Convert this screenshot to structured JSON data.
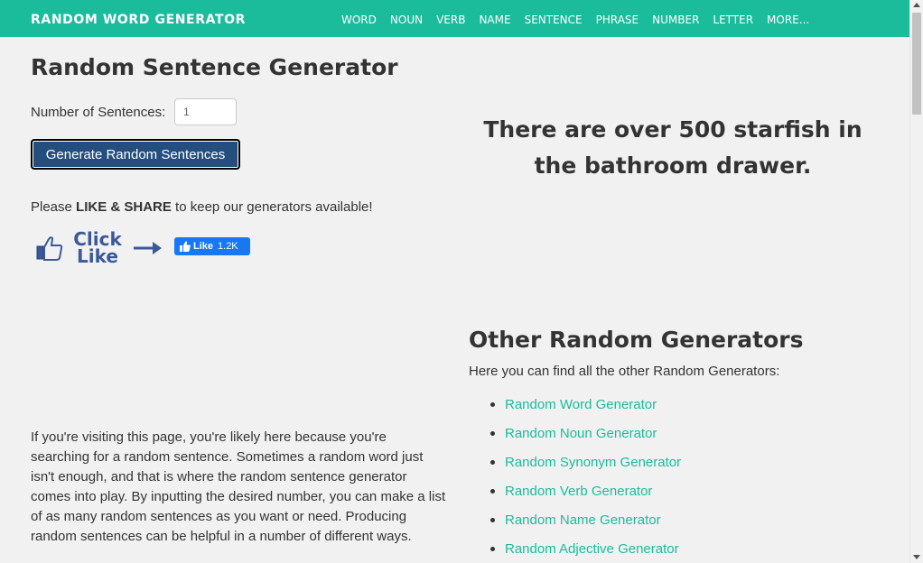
{
  "brand": "RANDOM WORD GENERATOR",
  "nav": [
    "WORD",
    "NOUN",
    "VERB",
    "NAME",
    "SENTENCE",
    "PHRASE",
    "NUMBER",
    "LETTER",
    "MORE..."
  ],
  "page_title": "Random Sentence Generator",
  "form": {
    "count_label": "Number of Sentences:",
    "count_value": "1",
    "button": "Generate Random Sentences"
  },
  "share": {
    "prefix": "Please ",
    "bold": "LIKE & SHARE",
    "suffix": " to keep our generators available!"
  },
  "click_like": {
    "line1": "Click",
    "line2": "Like"
  },
  "fb_like": {
    "label": "Like",
    "count": "1.2K"
  },
  "generated_sentence": "There are over 500 starfish in the bathroom drawer.",
  "description": "If you're visiting this page, you're likely here because you're searching for a random sentence. Sometimes a random word just isn't enough, and that is where the random sentence generator comes into play. By inputting the desired number, you can make a list of as many random sentences as you want or need. Producing random sentences can be helpful in a number of different ways.",
  "other": {
    "title": "Other Random Generators",
    "intro": "Here you can find all the other Random Generators:",
    "links": [
      "Random Word Generator",
      "Random Noun Generator",
      "Random Synonym Generator",
      "Random Verb Generator",
      "Random Name Generator",
      "Random Adjective Generator"
    ]
  },
  "colors": {
    "accent": "#1abc9c",
    "button": "#234e7d",
    "facebook": "#1877f2",
    "click_like": "#3b5998"
  },
  "icons": [
    "thumbs-up-icon",
    "arrow-right-icon",
    "facebook-like-icon"
  ]
}
